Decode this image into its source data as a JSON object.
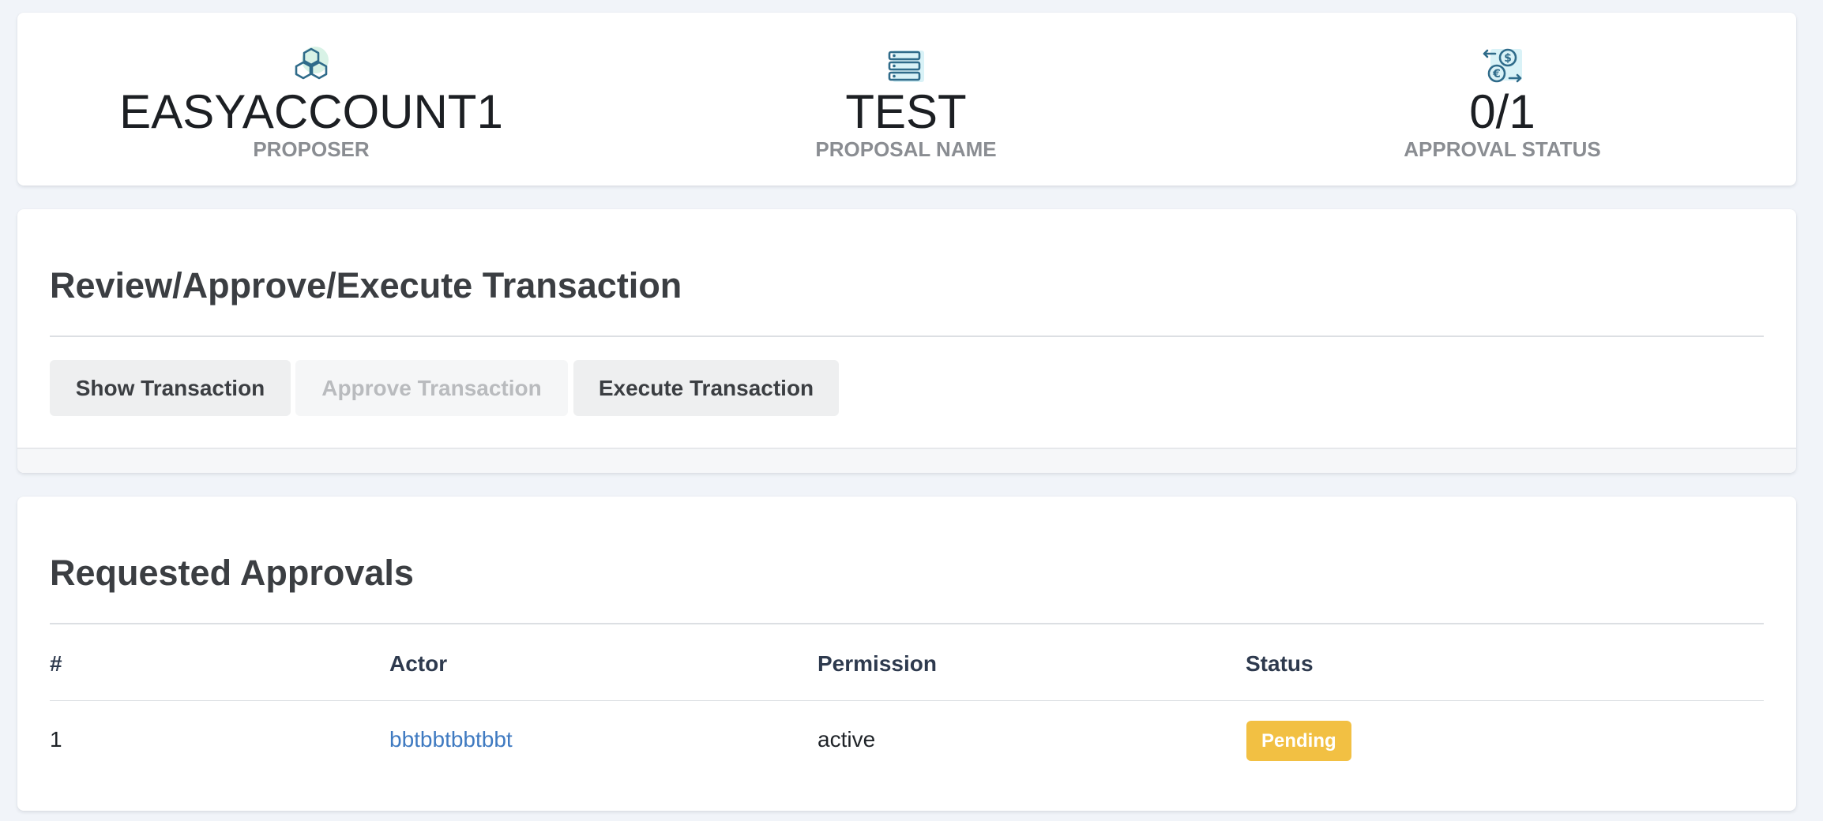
{
  "stats": [
    {
      "value": "EASYACCOUNT1",
      "label": "PROPOSER",
      "icon": "blocks-icon"
    },
    {
      "value": "TEST",
      "label": "PROPOSAL NAME",
      "icon": "server-icon"
    },
    {
      "value": "0/1",
      "label": "APPROVAL STATUS",
      "icon": "currency-exchange-icon"
    }
  ],
  "review": {
    "title": "Review/Approve/Execute Transaction",
    "buttons": {
      "show": "Show Transaction",
      "approve": "Approve Transaction",
      "execute": "Execute Transaction"
    }
  },
  "approvals": {
    "title": "Requested Approvals",
    "columns": [
      "#",
      "Actor",
      "Permission",
      "Status"
    ],
    "rows": [
      {
        "num": "1",
        "actor": "bbtbbtbbtbbt",
        "permission": "active",
        "status": "Pending"
      }
    ]
  },
  "colors": {
    "page_background": "#f1f4f9",
    "link": "#3f7ac1",
    "pending_badge": "#f2c043",
    "icon_stroke": "#2f6b8a",
    "icon_tint": "#d9f2ef"
  }
}
